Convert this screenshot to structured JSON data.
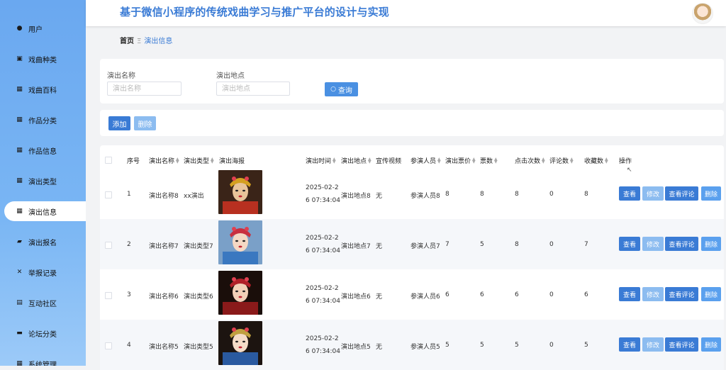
{
  "header": {
    "title": "基于微信小程序的传统戏曲学习与推广平台的设计与实现"
  },
  "sidebar": {
    "items": [
      {
        "label": "用户",
        "icon": "location-pin-icon",
        "glyph": "●"
      },
      {
        "label": "戏曲种类",
        "icon": "checkbox-icon",
        "glyph": "▣"
      },
      {
        "label": "戏曲百科",
        "icon": "grid-icon",
        "glyph": "▦"
      },
      {
        "label": "作品分类",
        "icon": "grid-icon",
        "glyph": "▦"
      },
      {
        "label": "作品信息",
        "icon": "grid-icon",
        "glyph": "▦"
      },
      {
        "label": "演出类型",
        "icon": "grid-nine-icon",
        "glyph": "▦"
      },
      {
        "label": "演出信息",
        "icon": "grid-icon",
        "glyph": "▦"
      },
      {
        "label": "演出报名",
        "icon": "folder-icon",
        "glyph": "▰"
      },
      {
        "label": "举报记录",
        "icon": "flag-icon",
        "glyph": "✕"
      },
      {
        "label": "互动社区",
        "icon": "clipboard-icon",
        "glyph": "▤"
      },
      {
        "label": "论坛分类",
        "icon": "briefcase-icon",
        "glyph": "▬"
      },
      {
        "label": "系统管理",
        "icon": "cog-icon",
        "glyph": "▦"
      }
    ],
    "active_index": 6
  },
  "breadcrumb": {
    "home": "首页",
    "separator": "Ξ",
    "current": "演出信息"
  },
  "search": {
    "name_label": "演出名称",
    "name_placeholder": "演出名称",
    "location_label": "演出地点",
    "location_placeholder": "演出地点",
    "button": "查询"
  },
  "toolbar": {
    "add": "添加",
    "delete": "删除"
  },
  "table": {
    "headers": [
      "序号",
      "演出名称",
      "演出类型",
      "演出海报",
      "演出时间",
      "演出地点",
      "宣传视频",
      "参演人员",
      "演出票价",
      "票数",
      "点击次数",
      "评论数",
      "收藏数",
      "操作"
    ],
    "rows": [
      {
        "index": "1",
        "name": "演出名称8",
        "type": "xx演出",
        "time_line1": "2025-02-2",
        "time_line2": "6 07:34:04",
        "location": "演出地点8",
        "video": "无",
        "performers": "参演人员8",
        "price": "8",
        "tickets": "8",
        "clicks": "8",
        "comments": "0",
        "favorites": "8"
      },
      {
        "index": "2",
        "name": "演出名称7",
        "type": "演出类型7",
        "time_line1": "2025-02-2",
        "time_line2": "6 07:34:04",
        "location": "演出地点7",
        "video": "无",
        "performers": "参演人员7",
        "price": "7",
        "tickets": "5",
        "clicks": "8",
        "comments": "0",
        "favorites": "7"
      },
      {
        "index": "3",
        "name": "演出名称6",
        "type": "演出类型6",
        "time_line1": "2025-02-2",
        "time_line2": "6 07:34:04",
        "location": "演出地点6",
        "video": "无",
        "performers": "参演人员6",
        "price": "6",
        "tickets": "6",
        "clicks": "6",
        "comments": "0",
        "favorites": "6"
      },
      {
        "index": "4",
        "name": "演出名称5",
        "type": "演出类型5",
        "time_line1": "2025-02-2",
        "time_line2": "6 07:34:04",
        "location": "演出地点5",
        "video": "无",
        "performers": "参演人员5",
        "price": "5",
        "tickets": "5",
        "clicks": "5",
        "comments": "0",
        "favorites": "5"
      }
    ],
    "actions": {
      "view": "查看",
      "edit": "修改",
      "view_comments": "查看评论",
      "delete": "删除"
    }
  },
  "colors": {
    "primary": "#3a7bd5",
    "light": "#8cbcf0",
    "sidebar": "#6aa8f0"
  }
}
